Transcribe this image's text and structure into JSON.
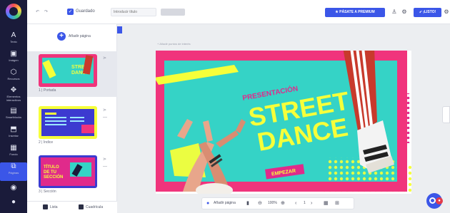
{
  "rail": {
    "items": [
      {
        "label": "Texto",
        "icon": "text-icon",
        "glyph": "A"
      },
      {
        "label": "Imágen",
        "icon": "image-icon",
        "glyph": "▣"
      },
      {
        "label": "Recursos",
        "icon": "resources-icon",
        "glyph": "⬡"
      },
      {
        "label": "Elementos interactivos",
        "icon": "interactive-icon",
        "glyph": "✥"
      },
      {
        "label": "Smartblocks",
        "icon": "smartblocks-icon",
        "glyph": "▤"
      },
      {
        "label": "Insertar",
        "icon": "insert-icon",
        "glyph": "⬒"
      },
      {
        "label": "Fondo",
        "icon": "background-icon",
        "glyph": "▦"
      },
      {
        "label": "Páginas",
        "icon": "pages-icon",
        "glyph": "⧉"
      },
      {
        "label": "",
        "icon": "settings-icon",
        "glyph": "◉"
      },
      {
        "label": "",
        "icon": "help-icon",
        "glyph": "●"
      }
    ]
  },
  "topbar": {
    "undo_glyph": "↶",
    "redo_glyph": "↷",
    "save_status": "Guardado",
    "search_placeholder": "Introducir título",
    "pill_label": "",
    "premium_label": "★ PÁSATE A PREMIUM",
    "icons": [
      "users-icon",
      "gear-icon"
    ],
    "present_label": "➶ ¡LISTO!",
    "settings_glyph": "⚙"
  },
  "panel": {
    "add_page_label": "Añadir página",
    "thumbnails": [
      {
        "label": "1 | Portada",
        "selected": true
      },
      {
        "label": "2 | Índice",
        "selected": false
      },
      {
        "label": "3 | Sección",
        "selected": false
      }
    ],
    "tabs": {
      "list": "Lista",
      "grid": "Cuadrícula"
    }
  },
  "canvas": {
    "crumb": "+ Añadir puntos de interés",
    "slide": {
      "eyebrow": "PRESENTACIÓN",
      "title_1": "STREET",
      "title_2": "DANCE",
      "cta": "EMPEZAR"
    },
    "bottom_bar": {
      "add_page": "Añadir página",
      "zoom": "100%",
      "page": "1"
    }
  },
  "colors": {
    "accent": "#3b56e8",
    "rail_bg": "#1a1b3a",
    "slide_pink": "#f0347c",
    "slide_teal": "#35d3c6",
    "slide_yellow": "#f6ff3a",
    "slide_magenta": "#e02a8b"
  }
}
